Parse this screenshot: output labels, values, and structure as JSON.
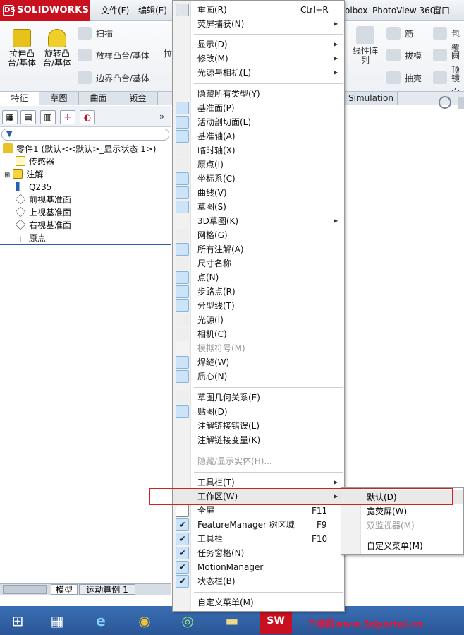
{
  "app": {
    "logo": "SOLIDWORKS"
  },
  "topmenu": {
    "file": "文件(F)",
    "edit": "编辑(E)",
    "toolbox": "olbox",
    "photoview": "PhotoView 360",
    "window": "窗口(W)"
  },
  "ribbon": {
    "extrude": "拉伸凸\n台/基体",
    "revolve": "旋转凸\n台/基体",
    "sweep": "扫描",
    "loft": "放样凸台/基体",
    "boundary": "边界凸台/基体",
    "linear_pattern": "线性阵\n列",
    "rib": "筋",
    "draft": "拔模",
    "shell": "抽壳",
    "wrap": "包覆",
    "dome": "圆顶",
    "mirror": "镜向",
    "partial": "拉"
  },
  "tabs": [
    "特征",
    "草图",
    "曲面",
    "钣金"
  ],
  "simulation_tab": "Simulation",
  "tree": {
    "root": "零件1 (默认<<默认>_显示状态 1>)",
    "items": [
      "传感器",
      "注解",
      "Q235",
      "前视基准面",
      "上视基准面",
      "右视基准面",
      "原点"
    ]
  },
  "bottom_tabs": [
    "模型",
    "运动算例 1"
  ],
  "menu": {
    "items": [
      {
        "label": "重画(R)",
        "shortcut": "Ctrl+R"
      },
      {
        "label": "荧屏捕获(N)",
        "arrow": true
      },
      {
        "label": "显示(D)",
        "arrow": true
      },
      {
        "label": "修改(M)",
        "arrow": true
      },
      {
        "label": "光源与相机(L)",
        "arrow": true
      },
      {
        "label": "隐藏所有类型(Y)"
      },
      {
        "label": "基准面(P)"
      },
      {
        "label": "活动剖切面(L)"
      },
      {
        "label": "基准轴(A)"
      },
      {
        "label": "临时轴(X)"
      },
      {
        "label": "原点(I)"
      },
      {
        "label": "坐标系(C)"
      },
      {
        "label": "曲线(V)"
      },
      {
        "label": "草图(S)"
      },
      {
        "label": "3D草图(K)",
        "arrow": true
      },
      {
        "label": "网格(G)"
      },
      {
        "label": "所有注解(A)"
      },
      {
        "label": "尺寸名称"
      },
      {
        "label": "点(N)"
      },
      {
        "label": "步路点(R)"
      },
      {
        "label": "分型线(T)"
      },
      {
        "label": "光源(I)"
      },
      {
        "label": "相机(C)"
      },
      {
        "label": "模拟符号(M)",
        "disabled": true
      },
      {
        "label": "焊缝(W)"
      },
      {
        "label": "质心(N)"
      },
      {
        "label": "草图几何关系(E)"
      },
      {
        "label": "贴图(D)"
      },
      {
        "label": "注解链接错误(L)"
      },
      {
        "label": "注解链接变量(K)"
      },
      {
        "label": "隐藏/显示实体(H)...",
        "disabled": true
      },
      {
        "label": "工具栏(T)",
        "arrow": true
      },
      {
        "label": "工作区(W)",
        "arrow": true
      },
      {
        "label": "全屏",
        "shortcut": "F11"
      },
      {
        "label": "FeatureManager 树区域",
        "shortcut": "F9"
      },
      {
        "label": "工具栏",
        "shortcut": "F10"
      },
      {
        "label": "任务窗格(N)"
      },
      {
        "label": "MotionManager"
      },
      {
        "label": "状态栏(B)"
      },
      {
        "label": "自定义菜单(M)"
      }
    ]
  },
  "submenu": {
    "items": [
      "默认(D)",
      "宽荧屏(W)",
      "双监视器(M)",
      "自定义菜单(M)"
    ]
  },
  "taskbar": {
    "watermark": "三维网www.3dportal.cn"
  },
  "colors": {
    "brand": "#c8101e",
    "taskbar": "#2a5696",
    "highlight_box": "#d61f1f"
  }
}
